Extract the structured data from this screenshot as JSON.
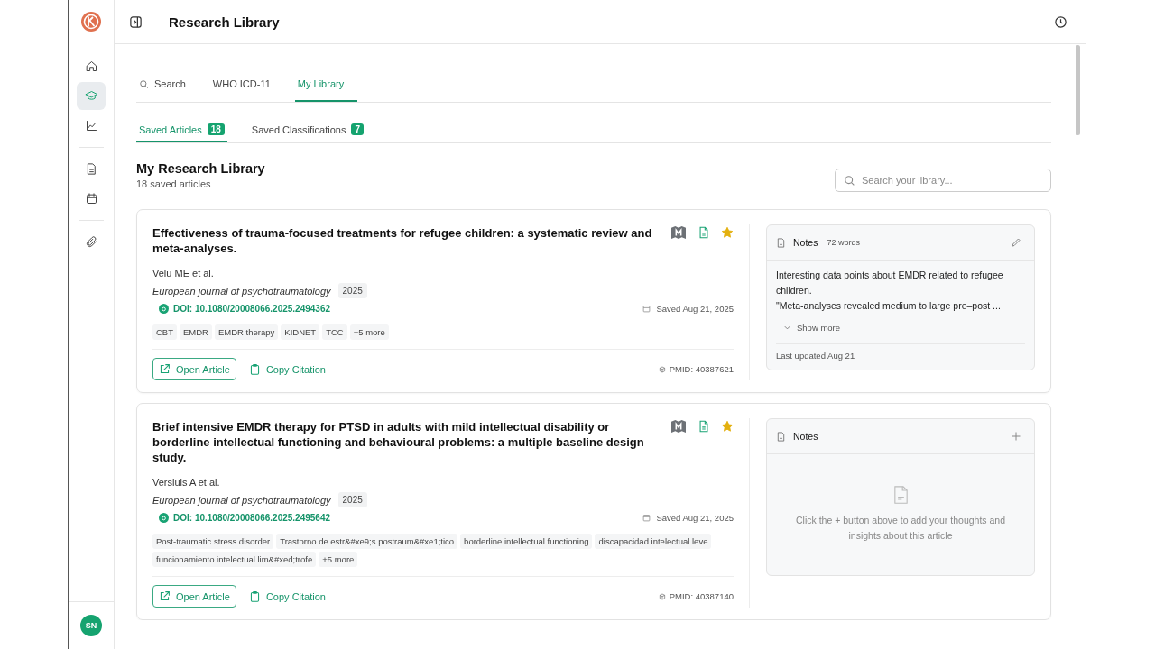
{
  "app": {
    "avatar": "SN"
  },
  "sidebar": {
    "items": [
      {
        "kind": "home",
        "selected": false
      },
      {
        "kind": "library",
        "selected": true
      },
      {
        "kind": "chart",
        "selected": false
      },
      {
        "kind": "divider"
      },
      {
        "kind": "document",
        "selected": false
      },
      {
        "kind": "calendar",
        "selected": false
      },
      {
        "kind": "divider"
      },
      {
        "kind": "attachment",
        "selected": false
      }
    ]
  },
  "header": {
    "title": "Research Library"
  },
  "tabs": [
    {
      "label": "Search",
      "kind": "search",
      "selected": false
    },
    {
      "label": "WHO ICD-11",
      "kind": "plain",
      "selected": false
    },
    {
      "label": "My Library",
      "kind": "plain",
      "selected": true
    }
  ],
  "subtabs": [
    {
      "label": "Saved Articles",
      "count": "18",
      "selected": true
    },
    {
      "label": "Saved Classifications",
      "count": "7",
      "selected": false
    }
  ],
  "library": {
    "title": "My Research Library",
    "subtitle": "18 saved articles",
    "search": {
      "placeholder": "Search your library..."
    }
  },
  "articles": [
    {
      "title": "Effectiveness of trauma-focused treatments for refugee children: a systematic review and meta-analyses.",
      "authors": "Velu ME et al.",
      "journal": "European journal of psychotraumatology",
      "year": "2025",
      "doi": "DOI: 10.1080/20008066.2025.2494362",
      "saved": "Saved Aug 21, 2025",
      "tags": [
        "CBT",
        "EMDR",
        "EMDR therapy",
        "KIDNET",
        "TCC",
        "+5 more"
      ],
      "open": "Open Article",
      "copy": "Copy Citation",
      "pmid": "PMID: 40387621",
      "starred": true,
      "notes": {
        "kind": "filled",
        "title": "Notes",
        "words": "72 words",
        "paragraphs": [
          "Interesting data points about EMDR related to refugee children.",
          "\"Meta-analyses revealed medium to large pre–post ..."
        ],
        "show_more": "Show more",
        "updated": "Last updated Aug 21"
      }
    },
    {
      "title": "Brief intensive EMDR therapy for PTSD in adults with mild intellectual disability or borderline intellectual functioning and behavioural problems: a multiple baseline design study.",
      "authors": "Versluis A et al.",
      "journal": "European journal of psychotraumatology",
      "year": "2025",
      "doi": "DOI: 10.1080/20008066.2025.2495642",
      "saved": "Saved Aug 21, 2025",
      "tags": [
        "Post-traumatic stress disorder",
        "Trastorno de estr&#xe9;s postraum&#xe1;tico",
        "borderline intellectual functioning",
        "discapacidad intelectual leve",
        "funcionamiento intelectual lim&#xed;trofe",
        "+5 more"
      ],
      "open": "Open Article",
      "copy": "Copy Citation",
      "pmid": "PMID: 40387140",
      "starred": true,
      "notes": {
        "kind": "empty",
        "title": "Notes",
        "hint": "Click the + button above to add your thoughts and insights about this article"
      }
    }
  ]
}
